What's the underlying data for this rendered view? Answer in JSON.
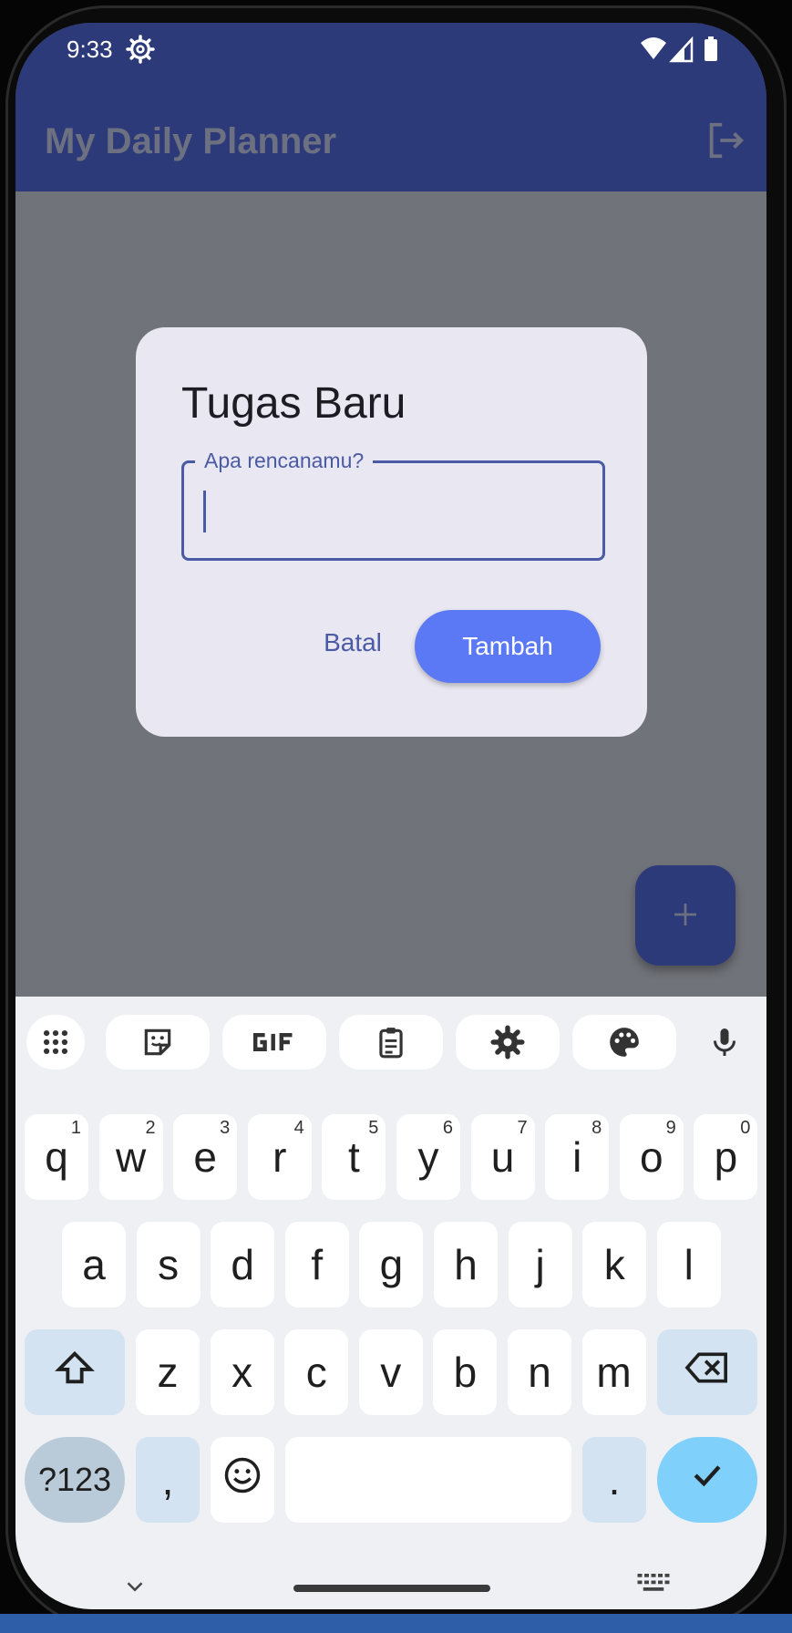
{
  "status_bar": {
    "time": "9:33"
  },
  "app_bar": {
    "title": "My Daily Planner"
  },
  "dialog": {
    "title": "Tugas Baru",
    "field_label": "Apa rencanamu?",
    "field_value": "",
    "cancel_label": "Batal",
    "add_label": "Tambah"
  },
  "fab": {
    "label": "+"
  },
  "keyboard": {
    "row1": [
      {
        "key": "q",
        "hint": "1"
      },
      {
        "key": "w",
        "hint": "2"
      },
      {
        "key": "e",
        "hint": "3"
      },
      {
        "key": "r",
        "hint": "4"
      },
      {
        "key": "t",
        "hint": "5"
      },
      {
        "key": "y",
        "hint": "6"
      },
      {
        "key": "u",
        "hint": "7"
      },
      {
        "key": "i",
        "hint": "8"
      },
      {
        "key": "o",
        "hint": "9"
      },
      {
        "key": "p",
        "hint": "0"
      }
    ],
    "row2": [
      "a",
      "s",
      "d",
      "f",
      "g",
      "h",
      "j",
      "k",
      "l"
    ],
    "row3": [
      "z",
      "x",
      "c",
      "v",
      "b",
      "n",
      "m"
    ],
    "symbols_label": "?123",
    "comma_label": ",",
    "period_label": "."
  },
  "colors": {
    "app_bar": "#2c3a7a",
    "accent": "#5b79f5",
    "dialog_bg": "#e9e7f1",
    "scrim": "#71737a"
  },
  "icons": {
    "status": [
      "settings-gear",
      "wifi",
      "signal",
      "battery"
    ],
    "app_bar": "logout",
    "toolbar": [
      "apps-grid",
      "sticker",
      "gif",
      "clipboard",
      "settings",
      "palette",
      "microphone"
    ]
  }
}
